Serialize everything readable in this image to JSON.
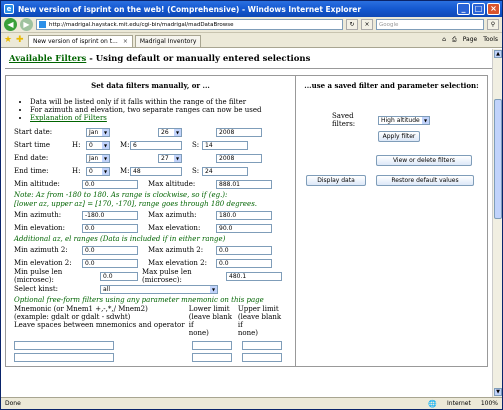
{
  "window": {
    "title": "New version of isprint on the web! (Comprehensive) - Windows Internet Explorer",
    "min": "_",
    "max": "□",
    "close": "×"
  },
  "address": {
    "url": "http://madrigal.haystack.mit.edu/cgi-bin/madrigal/madDataBrowse",
    "search_placeholder": "Google"
  },
  "tabs": [
    {
      "label": "New version of isprint on t..."
    },
    {
      "label": "Madrigal Inventory"
    }
  ],
  "toolbar": {
    "page": "Page",
    "tools": "Tools"
  },
  "page": {
    "link": "Available Filters",
    "title_rest": " - Using default or manually entered selections"
  },
  "left": {
    "title": "Set data filters manually, or ...",
    "bullets": [
      "Data will be listed only if it falls within the range of the filter",
      "For azimuth and elevation, two separate ranges can now be used"
    ],
    "explain_link": "Explanation of Filters",
    "start_date": {
      "label": "Start date:",
      "month": "Jan",
      "day": "26",
      "year": "2008"
    },
    "start_time": {
      "label": "Start time",
      "h_label": "H:",
      "h": "0",
      "m_label": "M:",
      "m": "6",
      "s_label": "S:",
      "s": "14"
    },
    "end_date": {
      "label": "End date:",
      "month": "Jan",
      "day": "27",
      "year": "2008"
    },
    "end_time": {
      "label": "End time:",
      "h_label": "H:",
      "h": "0",
      "m_label": "M:",
      "m": "48",
      "s_label": "S:",
      "s": "24"
    },
    "min_alt": {
      "label": "Min altitude:",
      "value": "0.0"
    },
    "max_alt": {
      "label": "Max altitude:",
      "value": "888.01"
    },
    "note1": "Note: Az from -180 to 180. As range is clockwise, so if (eg.):",
    "note2": "[lower az, upper az] = [170, -170], range goes through 180 degrees.",
    "min_az": {
      "label": "Min azimuth:",
      "value": "-180.0"
    },
    "max_az": {
      "label": "Max azimuth:",
      "value": "180.0"
    },
    "min_el": {
      "label": "Min elevation:",
      "value": "0.0"
    },
    "max_el": {
      "label": "Max elevation:",
      "value": "90.0"
    },
    "note3": "Additional az, el ranges (Data is included if in either range)",
    "min_az2": {
      "label": "Min azimuth 2:",
      "value": "0.0"
    },
    "max_az2": {
      "label": "Max azimuth 2:",
      "value": "0.0"
    },
    "min_el2": {
      "label": "Min elevation 2:",
      "value": "0.0"
    },
    "max_el2": {
      "label": "Max elevation 2:",
      "value": "0.0"
    },
    "min_pulse": {
      "label": "Min pulse len (microsec):",
      "value": "0.0"
    },
    "max_pulse": {
      "label": "Max pulse len (microsec):",
      "value": "480.1"
    },
    "kinst": {
      "label": "Select kinst:",
      "value": "all"
    },
    "note4": "Optional free-form filters using any parameter mnemonic on this page",
    "mnem1": "Mnemonic (or Mnem1 +,-,*,/ Mnem2)",
    "mnem2": "(example: gdalt or gdalt - sdwht)",
    "mnem3": "Leave spaces between mnemonics and operator",
    "lower1": "Lower limit",
    "lower2": "(leave blank if",
    "lower3": "none)",
    "upper1": "Upper limit",
    "upper2": "(leave blank if",
    "upper3": "none)"
  },
  "right": {
    "title": "...use a saved filter and parameter selection:",
    "saved_label": "Saved filters:",
    "saved_value": "High altitude",
    "apply": "Apply filter",
    "view_delete": "View or delete filters",
    "display": "Display data",
    "restore": "Restore default values"
  },
  "status": {
    "left": "Done",
    "zone": "Internet",
    "zoom": "100%"
  }
}
